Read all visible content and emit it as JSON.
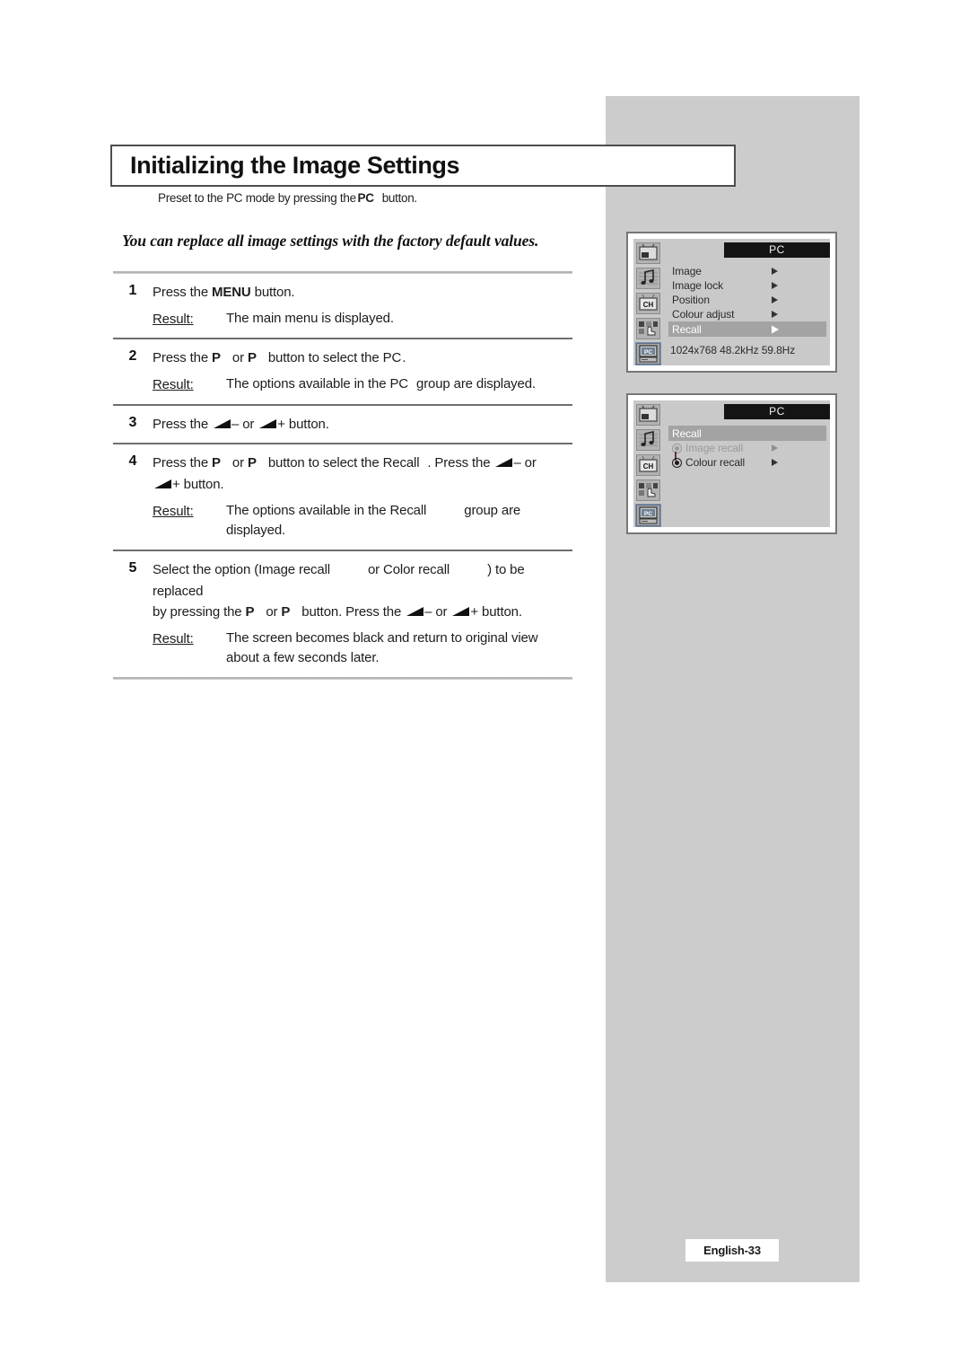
{
  "page": {
    "title": "Initializing the Image Settings",
    "preset_note_pre": "Preset to the PC mode by pressing the",
    "preset_note_key": "PC",
    "preset_note_post": "button.",
    "lead_in": "You can replace all image settings with the factory default values.",
    "footer_badge": "English-33"
  },
  "steps": [
    {
      "number": "1",
      "text_parts": [
        "Press the ",
        "MENU",
        " button."
      ],
      "result_label": "Result:",
      "result_text": "The main menu is displayed."
    },
    {
      "number": "2",
      "text_parts": [
        "Press the ",
        "P",
        " or ",
        "P",
        " button to select the ",
        "PC",
        "."
      ],
      "result_label": "Result:",
      "result_text": "The options available in the PC group are displayed."
    },
    {
      "number": "3",
      "text_parts": [
        "Press the ",
        "vol-down-icon",
        " – or ",
        "vol-up-icon",
        " + button."
      ],
      "result_label": "",
      "result_text": ""
    },
    {
      "number": "4",
      "text_parts": [
        "Press the ",
        "P",
        " or ",
        "P",
        " button to select the ",
        "Recall",
        ". Press the ",
        "vol-down-icon",
        " – or ",
        "vol-up-icon",
        " + button."
      ],
      "result_label": "Result:",
      "result_text": "The options available in the Recall group are displayed."
    },
    {
      "number": "5",
      "text_parts": [
        "Select the option (",
        "Image recall",
        " or ",
        "Color recall",
        ") to be replaced by pressing the ",
        "P",
        " or ",
        "P",
        " button. Press the ",
        "vol-down-icon",
        " – or ",
        "vol-up-icon",
        " + button."
      ],
      "result_label": "Result:",
      "result_text_line1": "The screen becomes black and return to original view",
      "result_text_line2": "about a few seconds later."
    }
  ],
  "step_text": {
    "s1_a": "Press the ",
    "s1_menu": "MENU",
    "s1_b": " button.",
    "s1_result_label": "Result:",
    "s1_result": "The main menu is displayed.",
    "s2_a": "Press the ",
    "s2_p1": "P",
    "s2_or": "or ",
    "s2_p2": "P",
    "s2_b": "button to select the ",
    "s2_pc": "PC",
    "s2_c": ".",
    "s2_result_label": "Result:",
    "s2_result_a": "The options available in the ",
    "s2_result_pc": "PC",
    "s2_result_b": "group are displayed.",
    "s3_a": "Press the ",
    "s3_minus": "– or ",
    "s3_plus": "+ button.",
    "s4_a": "Press the ",
    "s4_p1": "P",
    "s4_or": "or ",
    "s4_p2": "P",
    "s4_b": "button to select the ",
    "s4_recall": "Recall",
    "s4_c": ". Press the ",
    "s4_minus": "– or",
    "s4_plus": "+ button.",
    "s4_result_label": "Result:",
    "s4_result_a": "The options available in the ",
    "s4_result_recall": "Recall",
    "s4_result_b": "group are displayed.",
    "s5_a": "Select the option (",
    "s5_image_recall": "Image recall",
    "s5_or": "or ",
    "s5_color_recall": "Color recall",
    "s5_b": ") to be replaced",
    "s5_c": "by pressing the ",
    "s5_p1": "P",
    "s5_or2": "or ",
    "s5_p2": "P",
    "s5_d": "button. Press the ",
    "s5_minus": "– or ",
    "s5_plus": "+ button.",
    "s5_result_label": "Result:",
    "s5_result_line1": "The screen becomes black and return to original view",
    "s5_result_line2": "about a few seconds later."
  },
  "osd_screen_1": {
    "title": "PC",
    "rows": [
      {
        "label": "Image",
        "arrow": true,
        "highlighted": false
      },
      {
        "label": "Image lock",
        "arrow": true,
        "highlighted": false
      },
      {
        "label": "Position",
        "arrow": true,
        "highlighted": false
      },
      {
        "label": "Colour adjust",
        "arrow": true,
        "highlighted": false
      },
      {
        "label": "Recall",
        "arrow": true,
        "highlighted": true
      }
    ],
    "info": "1024x768  48.2kHz 59.8Hz",
    "sidebar_icons": [
      "picture-icon",
      "sound-icon",
      "channel-icon",
      "setup-icon",
      "pc-icon"
    ],
    "selected_sidebar_icon": "pc-icon"
  },
  "osd_screen_2": {
    "title": "PC",
    "group_label": "Recall",
    "rows": [
      {
        "label": "Image recall",
        "arrow": true,
        "radio": "off",
        "dim": true
      },
      {
        "label": "Colour recall",
        "arrow": true,
        "radio": "on",
        "dim": false
      }
    ],
    "sidebar_icons": [
      "picture-icon",
      "sound-icon",
      "channel-icon",
      "setup-icon",
      "pc-icon"
    ],
    "selected_sidebar_icon": "pc-icon"
  },
  "colors": {
    "panel_grey": "#cccccc",
    "osd_body": "#c9c9c9",
    "osd_highlight": "#a3a3a3",
    "osd_titlebar": "#141414",
    "rule": "#b8b8b8"
  }
}
